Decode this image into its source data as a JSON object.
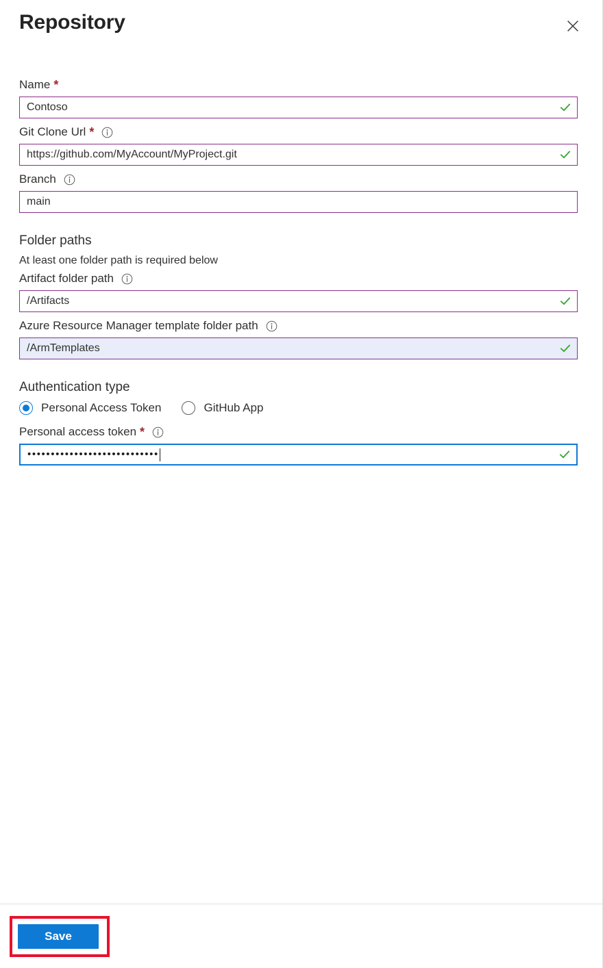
{
  "panel": {
    "title": "Repository",
    "close_icon": "close-icon"
  },
  "fields": {
    "name": {
      "label": "Name",
      "required_marker": "*",
      "value": "Contoso",
      "placeholder": "",
      "state": "valid"
    },
    "git_clone_url": {
      "label": "Git Clone Url",
      "required_marker": "*",
      "info_icon": "info-icon",
      "value": "https://github.com/MyAccount/MyProject.git",
      "placeholder": "",
      "state": "valid"
    },
    "branch": {
      "label": "Branch",
      "info_icon": "info-icon",
      "value": "main",
      "placeholder": "",
      "state": "default"
    },
    "artifact_folder_path": {
      "label": "Artifact folder path",
      "info_icon": "info-icon",
      "value": "/Artifacts",
      "placeholder": "",
      "state": "valid"
    },
    "arm_template_folder_path": {
      "label": "Azure Resource Manager template folder path",
      "info_icon": "info-icon",
      "value": "/ArmTemplates",
      "placeholder": "",
      "state": "valid-hovered"
    },
    "personal_access_token": {
      "label": "Personal access token",
      "required_marker": "*",
      "info_icon": "info-icon",
      "value": "••••••••••••••••••••••••••••",
      "placeholder": "",
      "state": "valid-focused"
    }
  },
  "sections": {
    "folder_paths": {
      "title": "Folder paths",
      "subtitle": "At least one folder path is required below"
    },
    "authentication": {
      "title": "Authentication type",
      "options": [
        {
          "label": "Personal Access Token",
          "selected": true
        },
        {
          "label": "GitHub App",
          "selected": false
        }
      ]
    }
  },
  "footer": {
    "save_label": "Save"
  },
  "colors": {
    "accent_blue": "#0f7ad4",
    "input_border_purple": "#8a2f8a",
    "required_red": "#a4262c",
    "valid_green": "#3da639",
    "annotation_red": "#e8112d",
    "hover_field_bg": "#e8edf9"
  }
}
